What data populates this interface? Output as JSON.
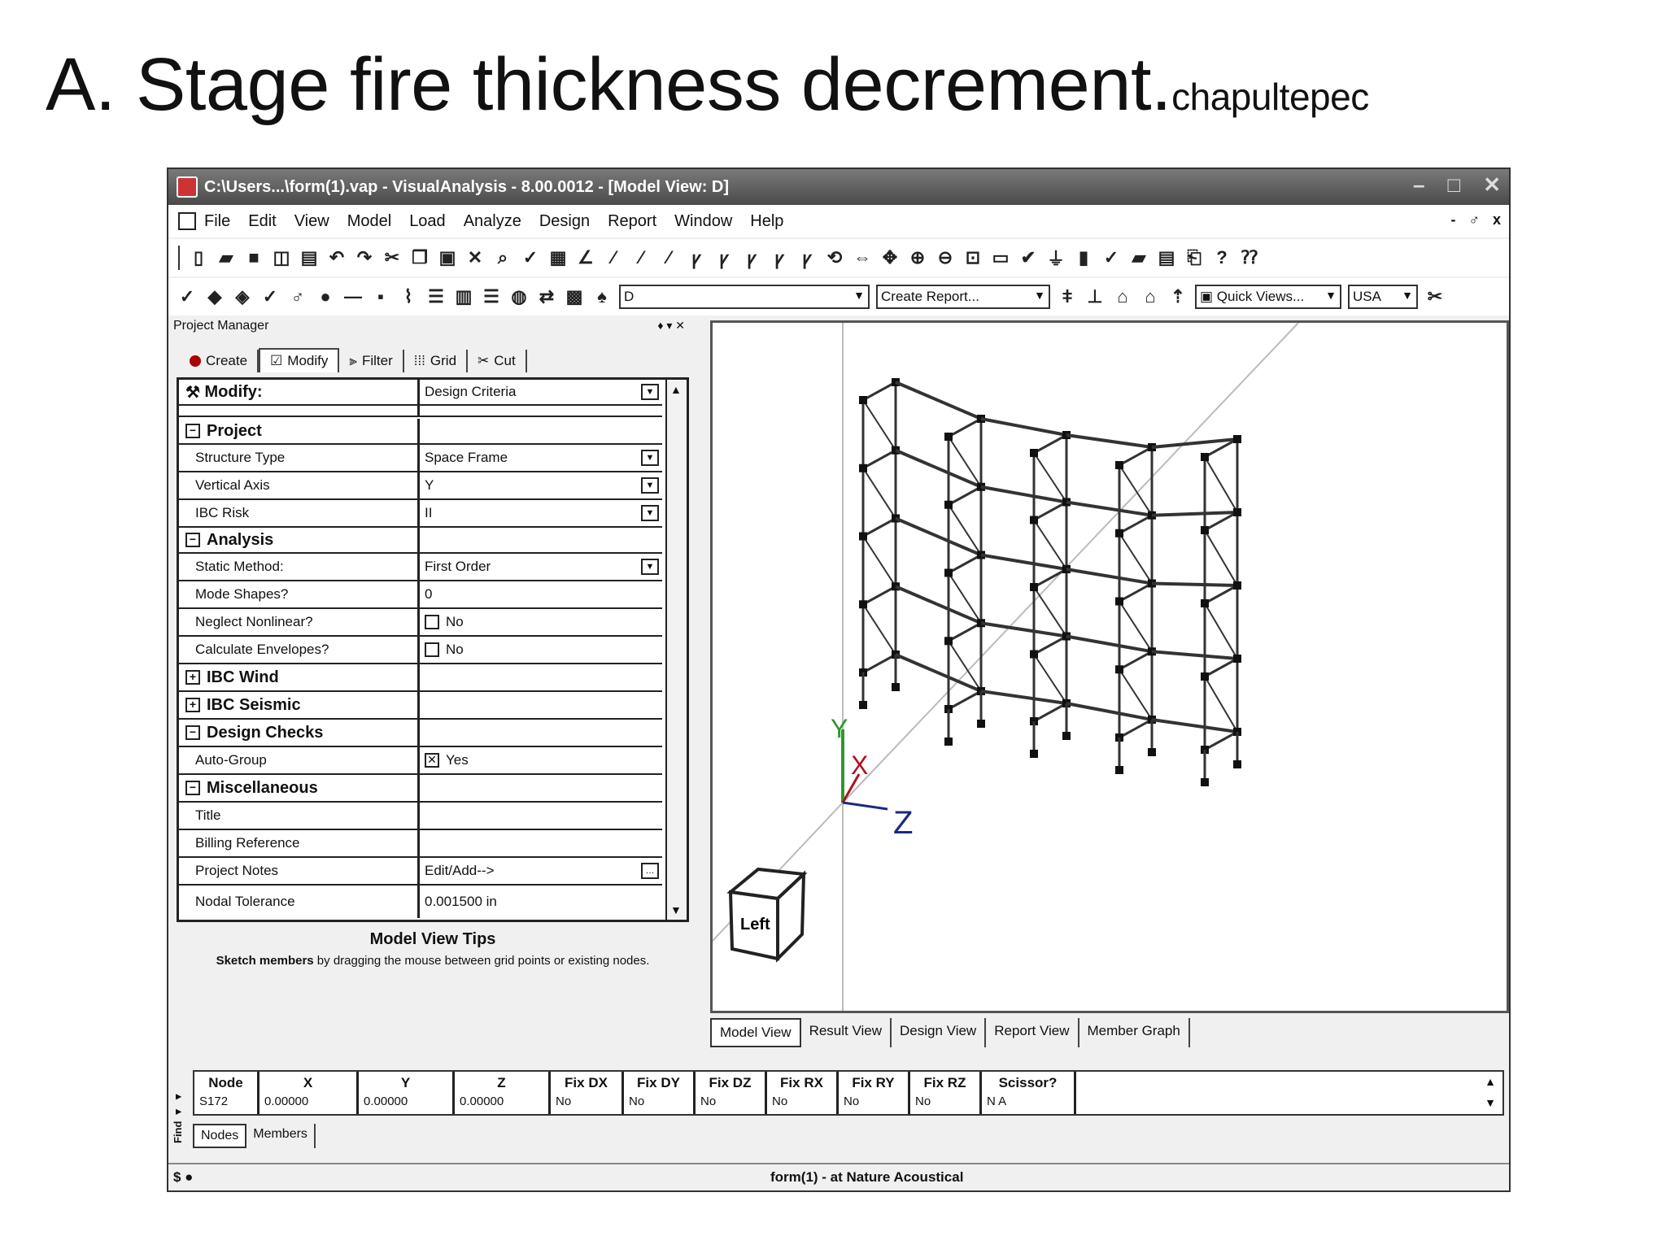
{
  "slide": {
    "title": "A. Stage fire thickness decrement.",
    "title_suffix": "chapultepec"
  },
  "window": {
    "title": "C:\\Users...\\form(1).vap - VisualAnalysis - 8.00.0012 - [Model View: D]",
    "minimize": "–",
    "maximize": "□",
    "close": "✕"
  },
  "menu": [
    "File",
    "Edit",
    "View",
    "Model",
    "Load",
    "Analyze",
    "Design",
    "Report",
    "Window",
    "Help"
  ],
  "mdi_controls": [
    "-",
    "♂",
    "x"
  ],
  "toolbar2": {
    "view_combo": "D",
    "report_combo": "Create Report...",
    "quick_views": "Quick Views...",
    "units_combo": "USA"
  },
  "project_manager": {
    "title": "Project Manager",
    "pins": "♦ ▾ ✕",
    "tabs": [
      "Create",
      "Modify",
      "Filter",
      "Grid",
      "Cut"
    ],
    "modify_label": "Modify:",
    "modify_value": "Design Criteria",
    "cat_project": "Project",
    "structure_type_k": "Structure Type",
    "structure_type_v": "Space Frame",
    "vertical_axis_k": "Vertical Axis",
    "vertical_axis_v": "Y",
    "ibc_risk_k": "IBC Risk",
    "ibc_risk_v": "II",
    "cat_analysis": "Analysis",
    "static_method_k": "Static Method:",
    "static_method_v": "First Order",
    "mode_shapes_k": "Mode Shapes?",
    "mode_shapes_v": "0",
    "neglect_k": "Neglect Nonlinear?",
    "neglect_v": "No",
    "envelopes_k": "Calculate Envelopes?",
    "envelopes_v": "No",
    "cat_wind": "IBC Wind",
    "cat_seismic": "IBC Seismic",
    "cat_design": "Design Checks",
    "autogroup_k": "Auto-Group",
    "autogroup_v": "Yes",
    "cat_misc": "Miscellaneous",
    "title_k": "Title",
    "billing_k": "Billing Reference",
    "notes_k": "Project Notes",
    "notes_v": "Edit/Add-->",
    "tolerance_k": "Nodal Tolerance",
    "tolerance_v": "0.001500 in"
  },
  "tips": {
    "title": "Model View Tips",
    "bold": "Sketch members",
    "text": " by dragging the mouse between grid points or existing nodes."
  },
  "view": {
    "axis_x": "X",
    "axis_y": "Y",
    "axis_z": "Z",
    "cube_label": "Left",
    "tabs": [
      "Model View",
      "Result View",
      "Design View",
      "Report View",
      "Member Graph"
    ]
  },
  "bottom_grid": {
    "side_caption": "Find ◂ ◂",
    "headers": [
      "Node",
      "X",
      "Y",
      "Z",
      "Fix DX",
      "Fix DY",
      "Fix DZ",
      "Fix RX",
      "Fix RY",
      "Fix RZ",
      "Scissor?"
    ],
    "row": [
      "S172",
      "0.00000",
      "0.00000",
      "0.00000",
      "No",
      "No",
      "No",
      "No",
      "No",
      "No",
      "N A"
    ],
    "tabs": [
      "Nodes",
      "Members"
    ]
  },
  "status": {
    "left": "$ ●",
    "middle": "form(1) -  at Nature Acoustical"
  },
  "colors": {
    "axis_x": "#b01020",
    "axis_y": "#2a9a2a",
    "axis_z": "#1a2a80",
    "frame": "#333333",
    "node": "#111111"
  }
}
